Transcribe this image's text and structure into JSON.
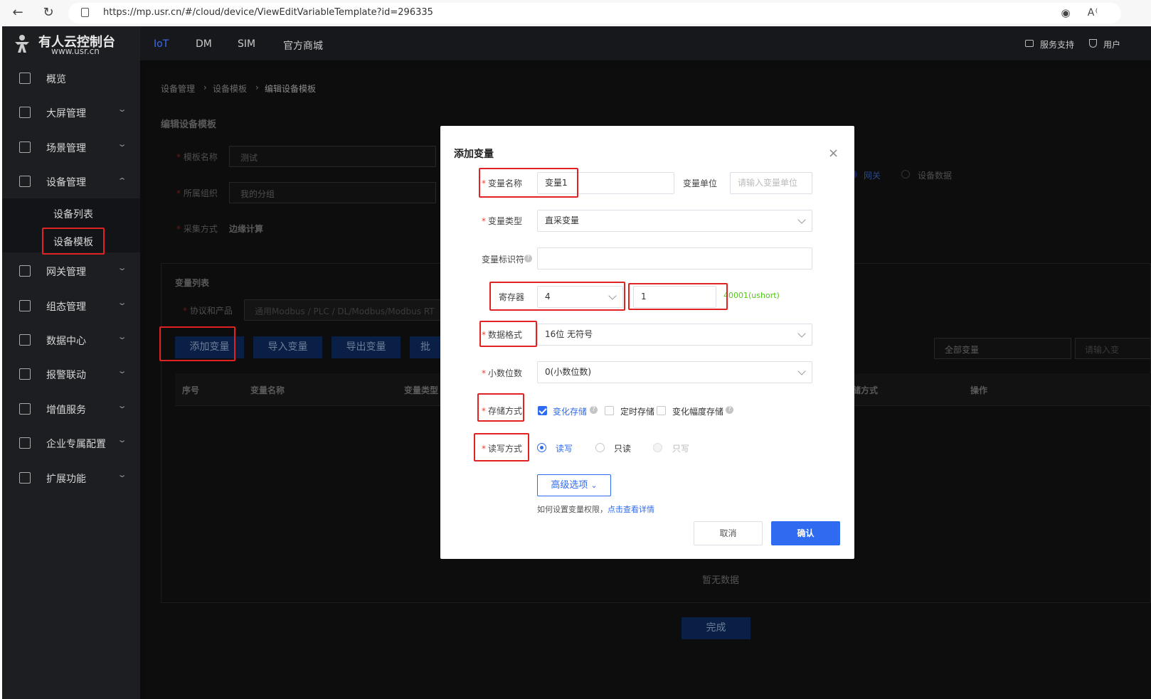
{
  "browser": {
    "url": "https://mp.usr.cn/#/cloud/device/ViewEditVariableTemplate?id=296335"
  },
  "app": {
    "logo_title": "有人云控制台",
    "logo_sub": "www.usr.cn",
    "top_tabs": [
      "IoT",
      "DM",
      "SIM",
      "官方商城"
    ],
    "top_right": [
      "服务支持",
      "用户"
    ],
    "sidebar": {
      "items": [
        "概览",
        "大屏管理",
        "场景管理",
        "设备管理",
        "网关管理",
        "组态管理",
        "数据中心",
        "报警联动",
        "增值服务",
        "企业专属配置",
        "扩展功能"
      ],
      "sub_items": [
        "设备列表",
        "设备模板"
      ]
    }
  },
  "page": {
    "breadcrumb": [
      "设备管理",
      "设备模板",
      "编辑设备模板"
    ],
    "section_title": "编辑设备模板",
    "template_name_label": "模板名称",
    "template_name_value": "测试",
    "org_label": "所属组织",
    "org_value": "我的分组",
    "collect_label": "采集方式",
    "collect_value": "边缘计算",
    "source_options": [
      "网关",
      "设备数据"
    ],
    "var_list_title": "变量列表",
    "protocol_label": "协议和产品",
    "protocol_value": "通用Modbus / PLC / DL/Modbus/Modbus RT",
    "buttons": [
      "添加变量",
      "导入变量",
      "导出变量",
      "批"
    ],
    "filter_select": "全部变量",
    "filter_search": "请输入变",
    "table_headers": [
      "序号",
      "变量名称",
      "变量类型",
      "存储方式",
      "操作"
    ],
    "empty_text": "暂无数据",
    "finish_button": "完成"
  },
  "modal": {
    "title": "添加变量",
    "close": "×",
    "var_name_label": "变量名称",
    "var_name_value": "变量1",
    "var_unit_label": "变量单位",
    "var_unit_placeholder": "请输入变量单位",
    "var_type_label": "变量类型",
    "var_type_value": "直采变量",
    "var_id_label": "变量标识符",
    "register_label": "寄存器",
    "register_value": "4",
    "register_addr": "1",
    "register_hint": "40001(ushort)",
    "data_format_label": "数据格式",
    "data_format_value": "16位 无符号",
    "decimal_label": "小数位数",
    "decimal_value": "0(小数位数)",
    "storage_label": "存储方式",
    "storage_options": [
      "变化存储",
      "定时存储",
      "变化幅度存储"
    ],
    "rw_label": "读写方式",
    "rw_options": [
      "读写",
      "只读",
      "只写"
    ],
    "advanced_button": "高级选项",
    "perm_text": "如何设置变量权限，",
    "perm_link": "点击查看详情",
    "cancel_button": "取消",
    "confirm_button": "确认"
  },
  "colors": {
    "accent": "#2f6bf0",
    "highlight": "#e12222",
    "hint": "#52c41a"
  }
}
